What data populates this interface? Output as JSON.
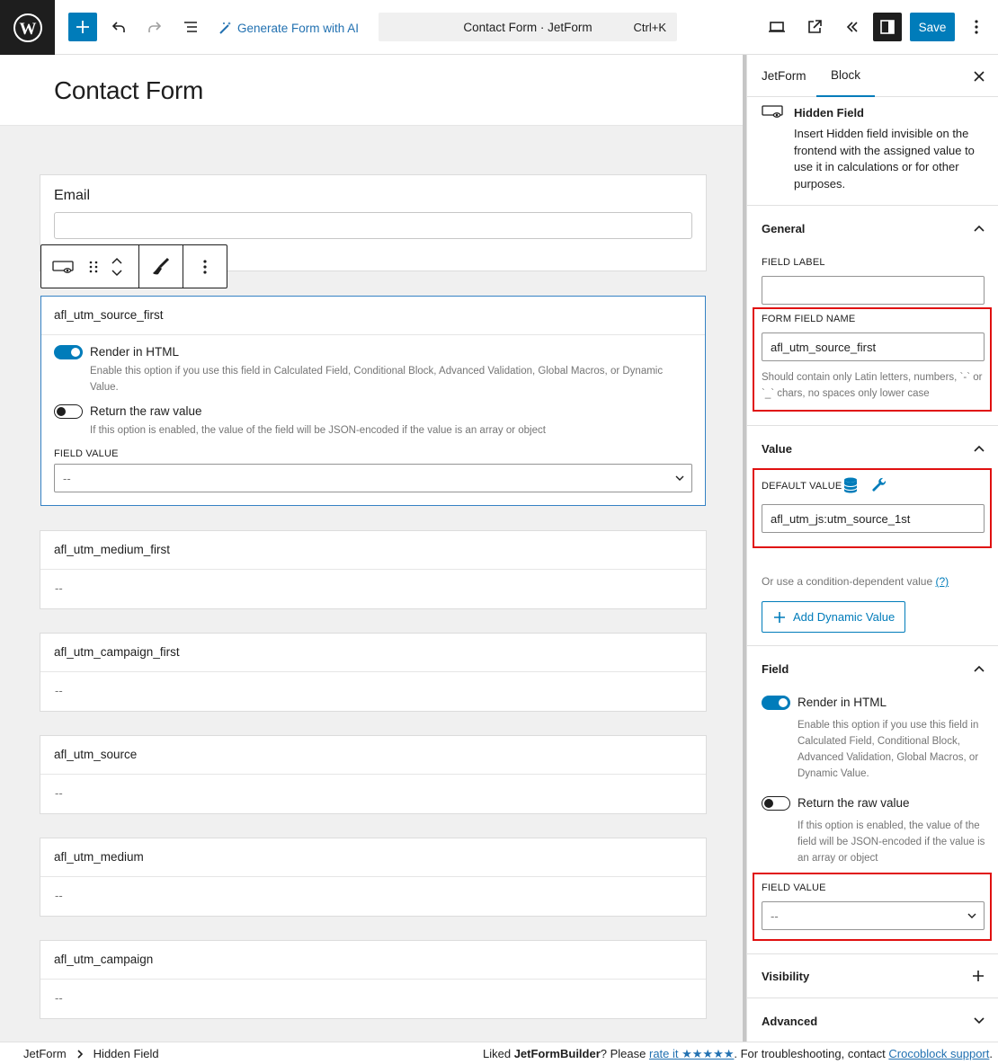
{
  "toolbar": {
    "generate_ai": "Generate Form with AI",
    "command_title": "Contact Form · JetForm",
    "shortcut": "Ctrl+K",
    "save": "Save"
  },
  "canvas": {
    "title": "Contact Form",
    "email_label": "Email",
    "selected_block": {
      "name": "afl_utm_source_first",
      "render_label": "Render in HTML",
      "render_help": "Enable this option if you use this field in Calculated Field, Conditional Block, Advanced Validation, Global Macros, or Dynamic Value.",
      "raw_label": "Return the raw value",
      "raw_help": "If this option is enabled, the value of the field will be JSON-encoded if the value is an array or object",
      "field_value_label": "FIELD VALUE",
      "field_value": "--"
    },
    "hidden_fields": [
      {
        "name": "afl_utm_medium_first",
        "value": "--"
      },
      {
        "name": "afl_utm_campaign_first",
        "value": "--"
      },
      {
        "name": "afl_utm_source",
        "value": "--"
      },
      {
        "name": "afl_utm_medium",
        "value": "--"
      },
      {
        "name": "afl_utm_campaign",
        "value": "--"
      }
    ]
  },
  "sidebar": {
    "tabs": [
      "JetForm",
      "Block"
    ],
    "block_title": "Hidden Field",
    "block_desc": "Insert Hidden field invisible on the frontend with the assigned value to use it in calculations or for other purposes.",
    "general": {
      "title": "General",
      "field_label": "FIELD LABEL",
      "field_label_value": "",
      "form_field_name_label": "FORM FIELD NAME",
      "form_field_name": "afl_utm_source_first",
      "form_field_name_help": "Should contain only Latin letters, numbers, `-` or `_` chars, no spaces only lower case"
    },
    "value": {
      "title": "Value",
      "default_label": "DEFAULT VALUE",
      "default_value": "afl_utm_js:utm_source_1st",
      "or_text": "Or use a condition-dependent value",
      "or_link": "(?)",
      "add_dynamic": "Add Dynamic Value"
    },
    "field": {
      "title": "Field",
      "render_label": "Render in HTML",
      "render_help": "Enable this option if you use this field in Calculated Field, Conditional Block, Advanced Validation, Global Macros, or Dynamic Value.",
      "raw_label": "Return the raw value",
      "raw_help": "If this option is enabled, the value of the field will be JSON-encoded if the value is an array or object",
      "field_value_label": "FIELD VALUE",
      "field_value": "--"
    },
    "visibility": "Visibility",
    "advanced": "Advanced"
  },
  "footer": {
    "crumbs": [
      "JetForm",
      "Hidden Field"
    ],
    "liked": "Liked ",
    "brand": "JetFormBuilder",
    "please": "? Please ",
    "rate": "rate it ★★★★★",
    "trouble": ". For troubleshooting, contact ",
    "support": "Crocoblock support",
    "end": "."
  },
  "colors": {
    "accent": "#007cba",
    "highlight_border": "#e01010",
    "selected_border": "#3582c4"
  }
}
